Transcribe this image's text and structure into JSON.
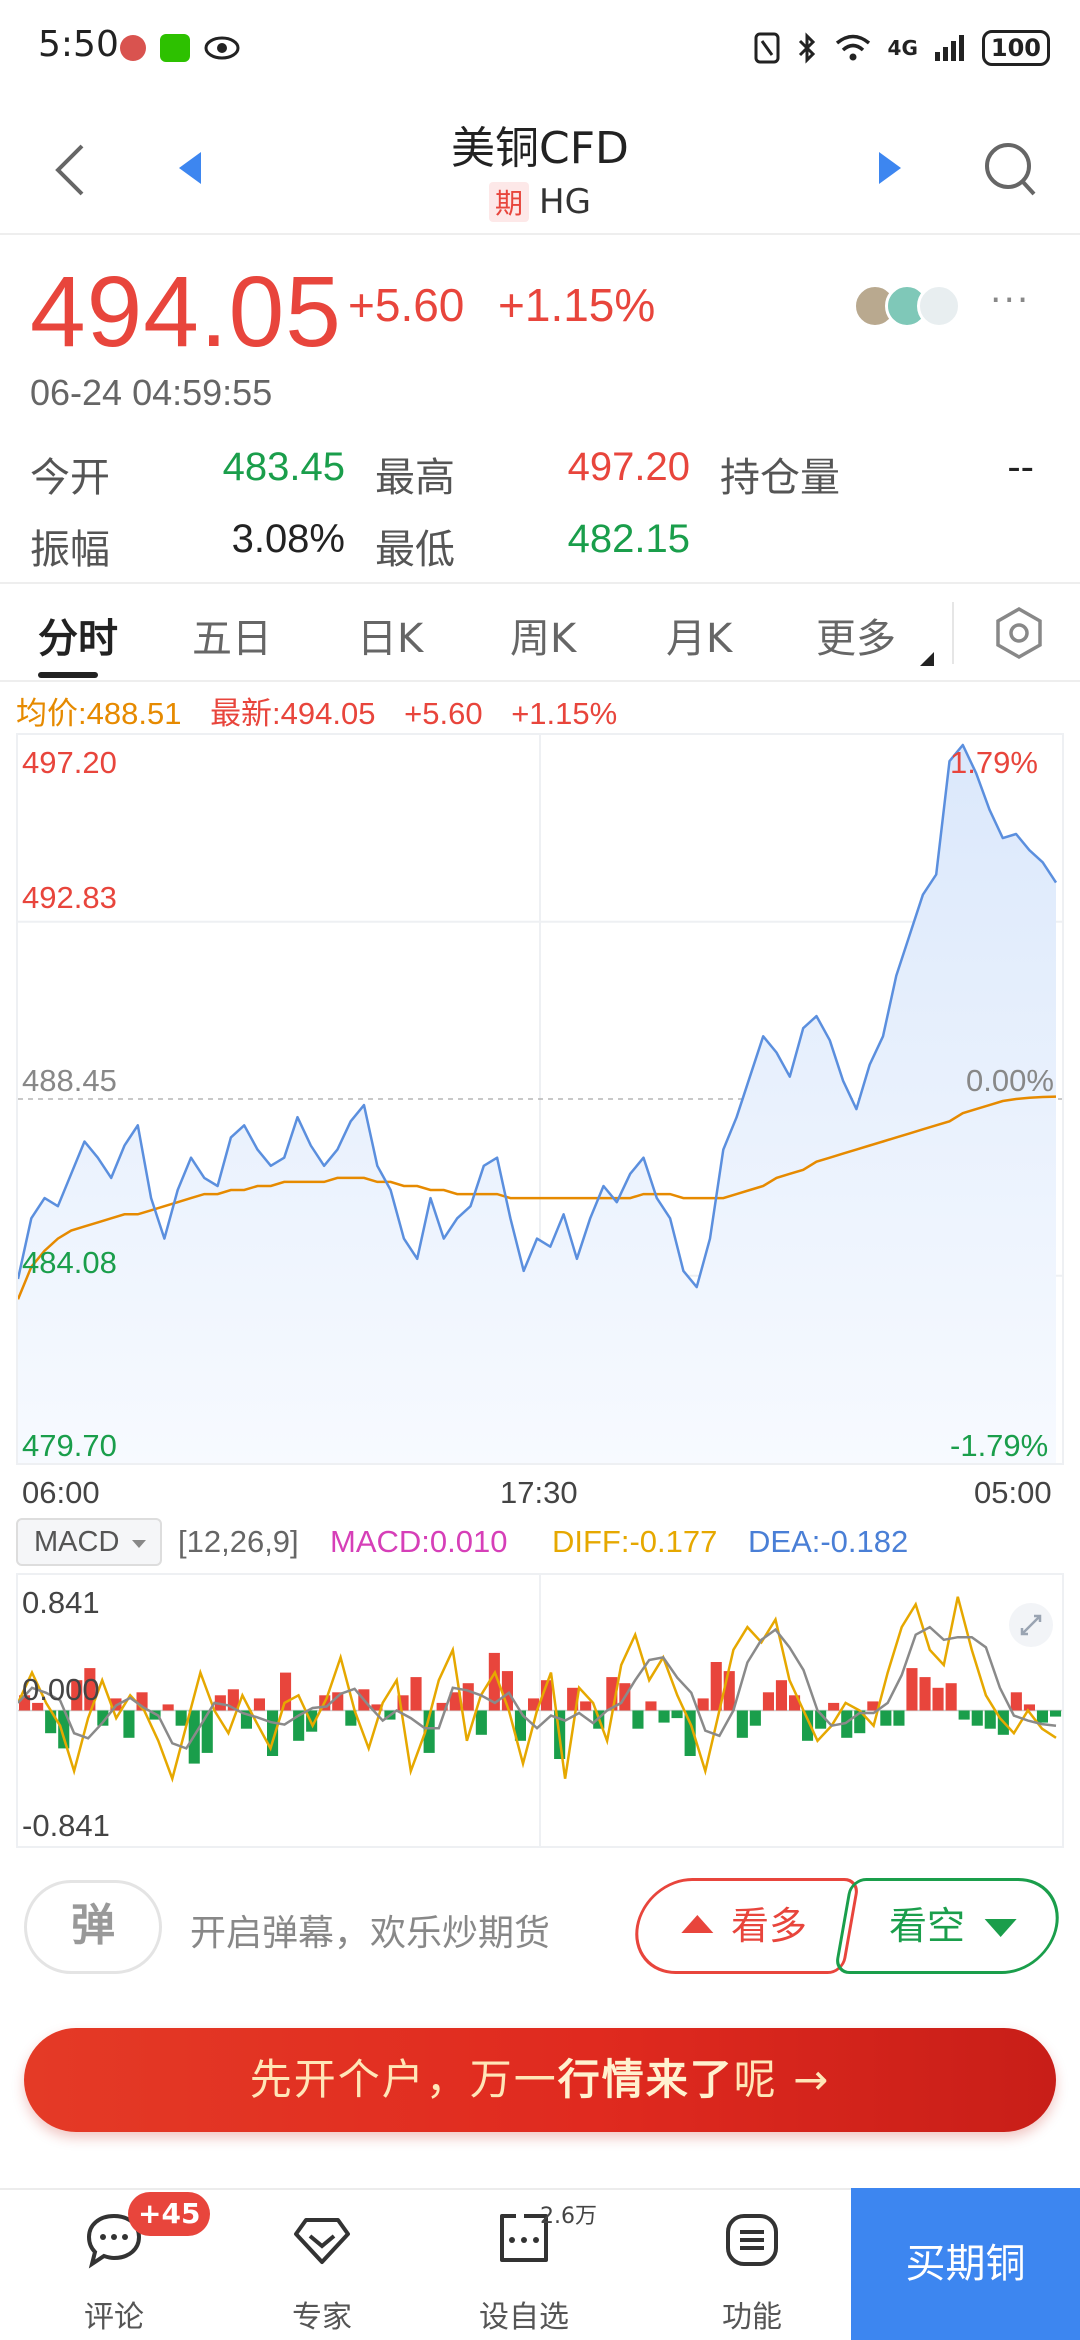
{
  "status_bar": {
    "time": "5:50",
    "network": "4G",
    "battery": "100"
  },
  "header": {
    "title": "美铜CFD",
    "futures_tag": "期",
    "symbol": "HG"
  },
  "quote": {
    "price": "494.05",
    "change": "+5.60",
    "change_pct": "+1.15%",
    "datetime": "06-24 04:59:55",
    "more": "···"
  },
  "stats": {
    "open_label": "今开",
    "open": "483.45",
    "high_label": "最高",
    "high": "497.20",
    "oi_label": "持仓量",
    "oi": "--",
    "amp_label": "振幅",
    "amp": "3.08%",
    "low_label": "最低",
    "low": "482.15"
  },
  "tabs": [
    "分时",
    "五日",
    "日K",
    "周K",
    "月K",
    "更多"
  ],
  "chart_header": {
    "avg": "均价:488.51",
    "latest": "最新:494.05",
    "change": "+5.60",
    "pct": "+1.15%"
  },
  "chart_data": {
    "type": "line",
    "x_ticks": [
      "06:00",
      "17:30",
      "05:00"
    ],
    "y_ticks_left": [
      "497.20",
      "492.83",
      "488.45",
      "484.08",
      "479.70"
    ],
    "y_ticks_right": [
      "1.79%",
      "0.00%",
      "-1.79%"
    ],
    "ylim": [
      479.7,
      497.2
    ],
    "prev_close": 488.45,
    "series": [
      {
        "name": "price",
        "color": "#5b8fde",
        "values": [
          484.0,
          485.5,
          486.0,
          485.8,
          486.6,
          487.4,
          487.0,
          486.5,
          487.3,
          487.8,
          486.0,
          485.0,
          486.2,
          487.0,
          486.5,
          486.3,
          487.5,
          487.8,
          487.2,
          486.8,
          487.0,
          488.0,
          487.3,
          486.8,
          487.2,
          487.9,
          488.3,
          486.8,
          486.2,
          485.0,
          484.5,
          486.0,
          485.0,
          485.5,
          485.8,
          486.8,
          487.0,
          485.5,
          484.2,
          485.0,
          484.8,
          485.6,
          484.5,
          485.5,
          486.3,
          485.9,
          486.6,
          487.0,
          486.0,
          485.5,
          484.2,
          483.8,
          485.0,
          487.2,
          488.0,
          489.0,
          490.0,
          489.6,
          489.0,
          490.2,
          490.5,
          489.9,
          488.9,
          488.2,
          489.3,
          490.0,
          491.5,
          492.5,
          493.5,
          494.0,
          496.8,
          497.2,
          496.5,
          495.6,
          494.9,
          495.0,
          494.6,
          494.3,
          493.8
        ]
      },
      {
        "name": "average",
        "color": "#e68a00",
        "values": [
          483.5,
          484.3,
          484.7,
          485.0,
          485.2,
          485.3,
          485.4,
          485.5,
          485.6,
          485.6,
          485.7,
          485.8,
          485.9,
          486.0,
          486.1,
          486.1,
          486.2,
          486.2,
          486.3,
          486.3,
          486.4,
          486.4,
          486.4,
          486.4,
          486.5,
          486.5,
          486.5,
          486.4,
          486.4,
          486.3,
          486.3,
          486.2,
          486.2,
          486.1,
          486.1,
          486.1,
          486.1,
          486.0,
          486.0,
          486.0,
          486.0,
          486.0,
          486.0,
          486.0,
          486.0,
          486.0,
          486.0,
          486.1,
          486.1,
          486.1,
          486.0,
          486.0,
          486.0,
          486.0,
          486.1,
          486.2,
          486.3,
          486.5,
          486.6,
          486.7,
          486.9,
          487.0,
          487.1,
          487.2,
          487.3,
          487.4,
          487.5,
          487.6,
          487.7,
          487.8,
          487.9,
          488.1,
          488.2,
          488.3,
          488.4,
          488.45,
          488.48,
          488.5,
          488.51
        ]
      }
    ]
  },
  "macd": {
    "select_label": "MACD",
    "params": "[12,26,9]",
    "macd": "MACD:0.010",
    "diff": "DIFF:-0.177",
    "dea": "DEA:-0.182",
    "y_ticks": [
      "0.841",
      "0.000",
      "-0.841"
    ],
    "ylim": [
      -0.841,
      0.841
    ],
    "colors": {
      "up": "#e8453c",
      "down": "#1a9e4b",
      "diff": "#e6a800",
      "dea": "#8a8a8a"
    },
    "histogram": [
      0.1,
      0.05,
      -0.15,
      -0.25,
      0.2,
      0.28,
      -0.1,
      0.08,
      -0.18,
      0.12,
      -0.06,
      0.04,
      -0.1,
      -0.35,
      -0.28,
      0.1,
      0.14,
      -0.12,
      0.08,
      -0.3,
      0.25,
      -0.2,
      -0.14,
      0.1,
      0.12,
      -0.1,
      0.14,
      0.04,
      -0.06,
      0.1,
      0.22,
      -0.28,
      0.05,
      0.12,
      0.18,
      -0.16,
      0.38,
      0.26,
      -0.2,
      0.08,
      0.2,
      -0.32,
      0.15,
      0.06,
      -0.12,
      0.22,
      0.18,
      -0.12,
      0.06,
      -0.08,
      -0.05,
      -0.3,
      0.08,
      0.32,
      0.26,
      -0.18,
      -0.1,
      0.12,
      0.2,
      0.1,
      -0.2,
      -0.12,
      0.05,
      -0.18,
      -0.15,
      0.06,
      -0.1,
      -0.1,
      0.28,
      0.22,
      0.15,
      0.18,
      -0.06,
      -0.1,
      -0.12,
      -0.16,
      0.12,
      0.04,
      -0.08,
      -0.04
    ],
    "diff_line": [
      0.05,
      0.25,
      0.05,
      -0.1,
      -0.4,
      -0.05,
      0.2,
      -0.05,
      0.1,
      0.0,
      -0.2,
      -0.45,
      -0.1,
      0.25,
      0.0,
      -0.15,
      0.1,
      -0.08,
      -0.25,
      0.05,
      0.1,
      -0.1,
      0.08,
      0.35,
      0.0,
      -0.25,
      0.05,
      0.2,
      -0.4,
      -0.15,
      0.2,
      0.4,
      -0.2,
      0.1,
      0.25,
      0.0,
      -0.35,
      0.0,
      0.25,
      -0.45,
      0.15,
      0.05,
      -0.2,
      0.3,
      0.5,
      0.2,
      0.35,
      0.1,
      -0.1,
      -0.4,
      0.0,
      0.4,
      0.55,
      0.45,
      0.6,
      0.2,
      0.0,
      -0.2,
      -0.1,
      0.05,
      0.0,
      -0.1,
      0.25,
      0.55,
      0.7,
      0.4,
      0.3,
      0.75,
      0.4,
      0.1,
      -0.05,
      -0.15,
      0.0,
      -0.12,
      -0.18
    ]
  },
  "actions": {
    "barrage_label": "弹",
    "barrage_hint": "开启弹幕，欢乐炒期货",
    "bull": "看多",
    "bear": "看空"
  },
  "cta": {
    "text_a": "先开个户，万一",
    "text_b": "行情来了",
    "text_c": "呢 →"
  },
  "bottom_nav": {
    "comment": "评论",
    "comment_badge": "+45",
    "expert": "专家",
    "watch": "设自选",
    "watch_count": "2.6万",
    "function": "功能",
    "buy": "买期铜"
  }
}
